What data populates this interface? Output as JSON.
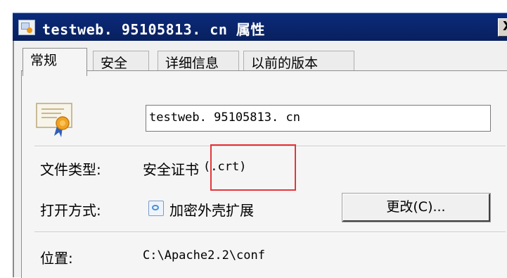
{
  "window": {
    "title": "testweb. 95105813. cn 属性",
    "close_label": "X"
  },
  "tabs": [
    {
      "label": "常规",
      "active": true
    },
    {
      "label": "安全",
      "active": false
    },
    {
      "label": "详细信息",
      "active": false
    },
    {
      "label": "以前的版本",
      "active": false
    }
  ],
  "general": {
    "file_name": "testweb. 95105813. cn",
    "file_type_label": "文件类型:",
    "file_type_value": "安全证书",
    "file_type_ext": "(.crt)",
    "open_with_label": "打开方式:",
    "open_with_value": "加密外壳扩展",
    "change_button": "更改(C)...",
    "location_label": "位置:",
    "location_value": "C:\\Apache2.2\\conf"
  },
  "colors": {
    "titlebar": "#0a246a",
    "highlight": "#e5363a"
  },
  "icons": {
    "title": "certificate-icon",
    "file": "certificate-icon",
    "app": "shell-extension-icon"
  }
}
